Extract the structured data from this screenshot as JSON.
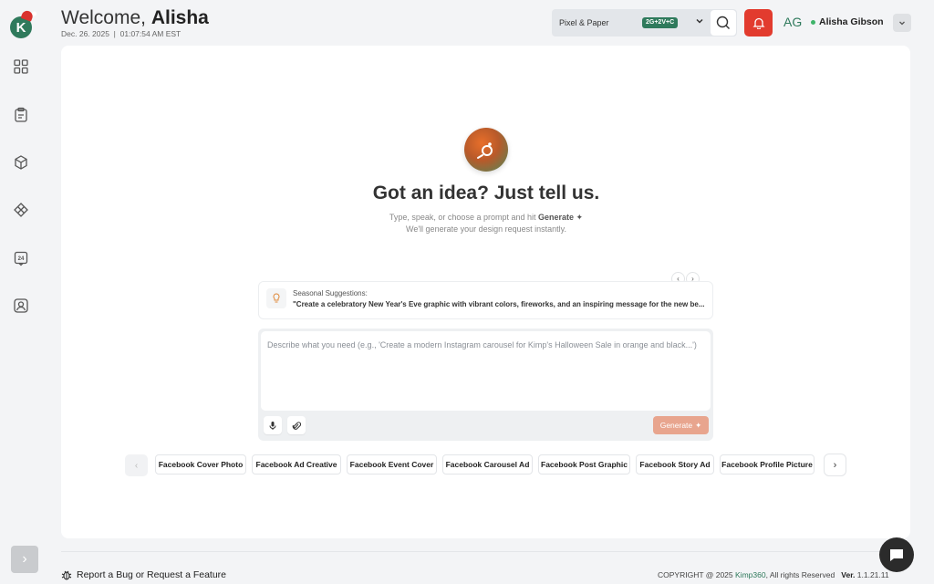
{
  "header": {
    "welcome_prefix": "Welcome,",
    "user_first_name": "Alisha",
    "date": "Dec. 26. 2025",
    "separator": "|",
    "time": "01:07:54 AM EST",
    "workspace_name": "Pixel & Paper",
    "workspace_badge": "2G+2V+C",
    "user_initials": "AG",
    "user_name": "Alisha Gibson"
  },
  "sidebar": {
    "logo_letter": "K",
    "items": [
      {
        "icon": "grid-icon"
      },
      {
        "icon": "clipboard-icon"
      },
      {
        "icon": "cube-icon"
      },
      {
        "icon": "diamond-nodes-icon"
      },
      {
        "icon": "calendar-24-icon",
        "badge": "24"
      },
      {
        "icon": "user-frame-icon"
      }
    ]
  },
  "hero": {
    "headline": "Got an idea? Just tell us.",
    "subtitle_prefix": "Type, speak, or choose a prompt and hit",
    "subtitle_action": "Generate",
    "subtitle_line2": "We'll generate your design request instantly."
  },
  "suggestion": {
    "label": "Seasonal Suggestions:",
    "text": "\"Create a celebratory New Year's Eve graphic with vibrant colors, fireworks, and an inspiring message for the new be..."
  },
  "prompt": {
    "placeholder": "Describe what you need (e.g., 'Create a modern Instagram carousel for Kimp's Halloween Sale in orange and black...')",
    "generate_label": "Generate"
  },
  "chips": [
    "Facebook Cover Photo",
    "Facebook Ad Creative",
    "Facebook Event Cover",
    "Facebook Carousel Ad",
    "Facebook Post Graphic",
    "Facebook Story Ad",
    "Facebook Profile Picture"
  ],
  "footer": {
    "report_label": "Report a Bug or Request a Feature",
    "copyright_prefix": "COPYRIGHT @ 2025",
    "brand": "Kimp360",
    "rights": ", All rights Reserved",
    "version_label": "Ver.",
    "version": "1.1.21.11"
  },
  "colors": {
    "brand_green": "#2f7a5c",
    "alert_red": "#e23b2e",
    "generate_disabled": "#e8a58e"
  }
}
